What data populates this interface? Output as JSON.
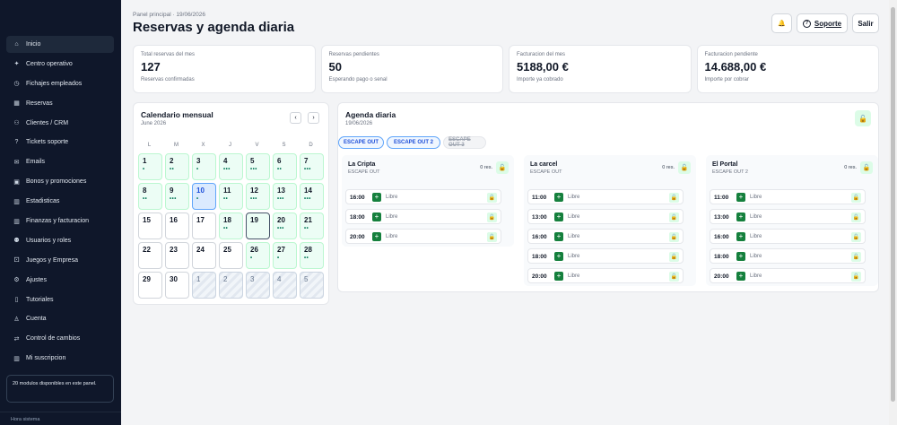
{
  "sidebar": {
    "items": [
      {
        "label": "Inicio",
        "icon": "home-icon",
        "glyph": "⌂"
      },
      {
        "label": "Centro operativo",
        "icon": "sparkle-icon",
        "glyph": "✦"
      },
      {
        "label": "Fichajes empleados",
        "icon": "clock-icon",
        "glyph": "◷"
      },
      {
        "label": "Reservas",
        "icon": "calendar-icon",
        "glyph": "▦"
      },
      {
        "label": "Clientes / CRM",
        "icon": "users-icon",
        "glyph": "⚇"
      },
      {
        "label": "Tickets soporte",
        "icon": "help-icon",
        "glyph": "?"
      },
      {
        "label": "Emails",
        "icon": "mail-icon",
        "glyph": "✉"
      },
      {
        "label": "Bonos y promociones",
        "icon": "gift-icon",
        "glyph": "▣"
      },
      {
        "label": "Estadisticas",
        "icon": "bar-chart-icon",
        "glyph": "▥"
      },
      {
        "label": "Finanzas y facturacion",
        "icon": "bar-chart-icon",
        "glyph": "▥"
      },
      {
        "label": "Usuarios y roles",
        "icon": "people-icon",
        "glyph": "⚉"
      },
      {
        "label": "Juegos y Empresa",
        "icon": "gamepad-icon",
        "glyph": "⚀"
      },
      {
        "label": "Ajustes",
        "icon": "gear-icon",
        "glyph": "⚙"
      },
      {
        "label": "Tutoriales",
        "icon": "book-icon",
        "glyph": "▯"
      },
      {
        "label": "Cuenta",
        "icon": "user-icon",
        "glyph": "♙"
      },
      {
        "label": "Control de cambios",
        "icon": "swap-icon",
        "glyph": "⇄"
      },
      {
        "label": "Mi suscripcion",
        "icon": "bar-chart-icon",
        "glyph": "▥"
      }
    ],
    "note": "20 modulos disponibles en este panel.",
    "footer": "Hora sistema"
  },
  "header": {
    "breadcrumb": "Panel principal · 19/06/2026",
    "title": "Reservas y agenda diaria",
    "bell_glyph": "🔔",
    "soporte_label": "Soporte",
    "salir_label": "Salir"
  },
  "stats": [
    {
      "label": "Total reservas del mes",
      "value": "127",
      "sub": "Reservas confirmadas"
    },
    {
      "label": "Reservas pendientes",
      "value": "50",
      "sub": "Esperando pago o senal"
    },
    {
      "label": "Facturacion del mes",
      "value": "5188,00 €",
      "sub": "Importe ya cobrado"
    },
    {
      "label": "Facturacion pendiente",
      "value": "14.688,00 €",
      "sub": "Importe por cobrar"
    }
  ],
  "calendar": {
    "title": "Calendario mensual",
    "month": "June 2026",
    "prev": "‹",
    "next": "›",
    "weekdays": [
      "L",
      "M",
      "X",
      "J",
      "V",
      "S",
      "D"
    ],
    "days": [
      {
        "n": "1",
        "dots": "•",
        "state": "g"
      },
      {
        "n": "2",
        "dots": "••",
        "state": "g"
      },
      {
        "n": "3",
        "dots": "•",
        "state": "g"
      },
      {
        "n": "4",
        "dots": "•••",
        "state": "g"
      },
      {
        "n": "5",
        "dots": "•••",
        "state": "g"
      },
      {
        "n": "6",
        "dots": "••",
        "state": "g"
      },
      {
        "n": "7",
        "dots": "•••",
        "state": "g"
      },
      {
        "n": "8",
        "dots": "••",
        "state": "g"
      },
      {
        "n": "9",
        "dots": "•••",
        "state": "g"
      },
      {
        "n": "10",
        "dots": "•",
        "state": "sel"
      },
      {
        "n": "11",
        "dots": "••",
        "state": "g"
      },
      {
        "n": "12",
        "dots": "•••",
        "state": "g"
      },
      {
        "n": "13",
        "dots": "•••",
        "state": "g"
      },
      {
        "n": "14",
        "dots": "•••",
        "state": "g"
      },
      {
        "n": "15",
        "dots": "",
        "state": "n"
      },
      {
        "n": "16",
        "dots": "",
        "state": "n"
      },
      {
        "n": "17",
        "dots": "",
        "state": "n"
      },
      {
        "n": "18",
        "dots": "••",
        "state": "g"
      },
      {
        "n": "19",
        "dots": "",
        "state": "today"
      },
      {
        "n": "20",
        "dots": "•••",
        "state": "g"
      },
      {
        "n": "21",
        "dots": "••",
        "state": "g"
      },
      {
        "n": "22",
        "dots": "",
        "state": "n"
      },
      {
        "n": "23",
        "dots": "",
        "state": "n"
      },
      {
        "n": "24",
        "dots": "",
        "state": "n"
      },
      {
        "n": "25",
        "dots": "",
        "state": "n"
      },
      {
        "n": "26",
        "dots": "•",
        "state": "g"
      },
      {
        "n": "27",
        "dots": "•",
        "state": "g"
      },
      {
        "n": "28",
        "dots": "••",
        "state": "g"
      },
      {
        "n": "29",
        "dots": "",
        "state": "n"
      },
      {
        "n": "30",
        "dots": "",
        "state": "n"
      },
      {
        "n": "1",
        "dots": "",
        "state": "out"
      },
      {
        "n": "2",
        "dots": "",
        "state": "out"
      },
      {
        "n": "3",
        "dots": "",
        "state": "out"
      },
      {
        "n": "4",
        "dots": "",
        "state": "out"
      },
      {
        "n": "5",
        "dots": "",
        "state": "out"
      }
    ]
  },
  "agenda": {
    "title": "Agenda diaria",
    "date": "19/06/2026",
    "lock_glyph": "🔓",
    "chips": [
      {
        "label": "ESCAPE OUT",
        "active": true
      },
      {
        "label": "ESCAPE OUT 2",
        "active": true
      },
      {
        "label": "ESCAPE OUT 3",
        "active": false
      }
    ],
    "rooms": [
      {
        "name": "La Cripta",
        "venue": "ESCAPE OUT",
        "res": "0 res.",
        "slots": [
          {
            "time": "16:00",
            "status": "Libre"
          },
          {
            "time": "18:00",
            "status": "Libre"
          },
          {
            "time": "20:00",
            "status": "Libre"
          }
        ]
      },
      {
        "name": "La carcel",
        "venue": "ESCAPE OUT",
        "res": "0 res.",
        "slots": [
          {
            "time": "11:00",
            "status": "Libre"
          },
          {
            "time": "13:00",
            "status": "Libre"
          },
          {
            "time": "16:00",
            "status": "Libre"
          },
          {
            "time": "18:00",
            "status": "Libre"
          },
          {
            "time": "20:00",
            "status": "Libre"
          }
        ]
      },
      {
        "name": "El Portal",
        "venue": "ESCAPE OUT 2",
        "res": "0 res.",
        "slots": [
          {
            "time": "11:00",
            "status": "Libre"
          },
          {
            "time": "13:00",
            "status": "Libre"
          },
          {
            "time": "16:00",
            "status": "Libre"
          },
          {
            "time": "18:00",
            "status": "Libre"
          },
          {
            "time": "20:00",
            "status": "Libre"
          }
        ]
      }
    ],
    "add_glyph": "+"
  },
  "colors": {
    "sidebar_bg": "#0f172a",
    "accent_green": "#15803d",
    "accent_blue": "#1d4ed8"
  }
}
